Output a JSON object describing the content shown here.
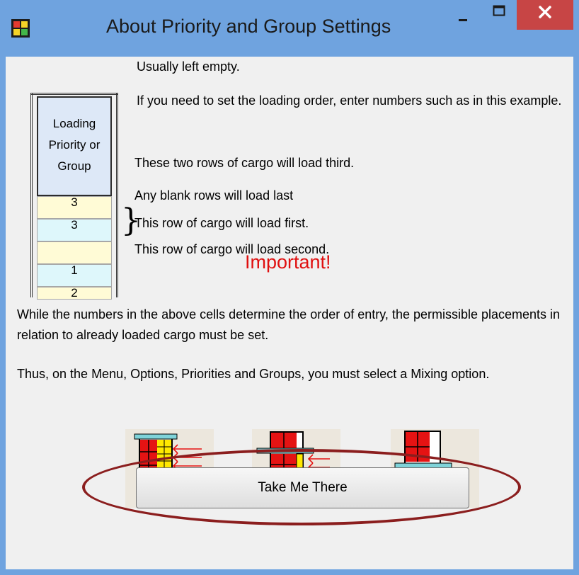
{
  "window": {
    "title": "About Priority and Group Settings"
  },
  "table": {
    "header": "Loading\nPriority or\nGroup",
    "rows": [
      "3",
      "3",
      "",
      "1",
      "2"
    ]
  },
  "notes": {
    "usually_empty": "Usually left empty.",
    "set_order": "If you need to set the loading order, enter numbers such as in this example.",
    "third": "These two rows of cargo will load third.",
    "blank": "Any blank rows will load last",
    "first": "This row of cargo will load first.",
    "second": "This row of cargo will load second."
  },
  "important": "Important!",
  "paragraph1": "While the numbers in the above cells determine the order of entry, the permissible placements in relation to already loaded cargo must be set.",
  "paragraph2": "Thus, on the Menu, Options, Priorities and Groups, you must select a Mixing option.",
  "button": {
    "label": "Take Me There"
  },
  "colors": {
    "titlebar": "#6fa3df",
    "close": "#c74545",
    "important": "#e01010",
    "oval": "#8b1e1e",
    "cell_yellow": "#fffbd6",
    "cell_blue": "#def7fb"
  }
}
